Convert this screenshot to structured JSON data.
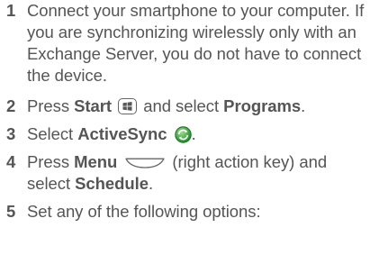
{
  "steps": [
    {
      "number": "1",
      "text": "Connect your smartphone to your computer. If you are synchronizing wirelessly only with an Exchange Server, you do not have to connect the device."
    },
    {
      "number": "2",
      "pre": "Press ",
      "bold1": "Start",
      "mid": " and select ",
      "bold2": "Programs",
      "post": "."
    },
    {
      "number": "3",
      "pre": "Select ",
      "bold1": "ActiveSync",
      "post": "."
    },
    {
      "number": "4",
      "pre": "Press ",
      "bold1": "Menu",
      "mid": " (right action key) and select ",
      "bold2": "Schedule",
      "post": "."
    },
    {
      "number": "5",
      "text": "Set any of the following options:"
    }
  ],
  "icons": {
    "start": "windows-start-icon",
    "activesync": "activesync-icon",
    "menu_key": "right-action-key-icon"
  },
  "colors": {
    "text": "#555555",
    "sync_green": "#2e9e2e"
  }
}
